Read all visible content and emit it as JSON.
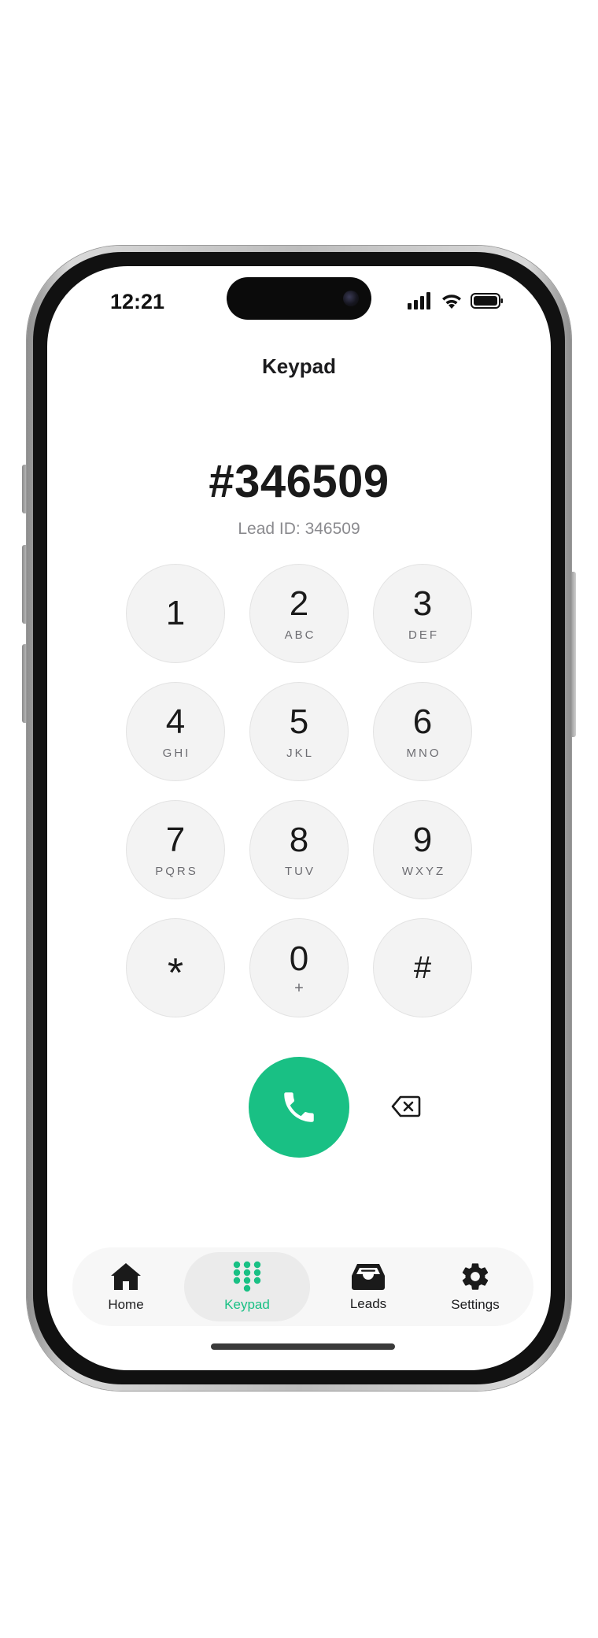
{
  "status_bar": {
    "time": "12:21",
    "icons": [
      "cellular-signal-icon",
      "wifi-icon",
      "battery-icon"
    ]
  },
  "header": {
    "title": "Keypad"
  },
  "dialer": {
    "number": "#346509",
    "lead_label": "Lead ID: 346509"
  },
  "keypad": {
    "keys": [
      {
        "digit": "1",
        "letters": ""
      },
      {
        "digit": "2",
        "letters": "ABC"
      },
      {
        "digit": "3",
        "letters": "DEF"
      },
      {
        "digit": "4",
        "letters": "GHI"
      },
      {
        "digit": "5",
        "letters": "JKL"
      },
      {
        "digit": "6",
        "letters": "MNO"
      },
      {
        "digit": "7",
        "letters": "PQRS"
      },
      {
        "digit": "8",
        "letters": "TUV"
      },
      {
        "digit": "9",
        "letters": "WXYZ"
      },
      {
        "digit": "*",
        "letters": ""
      },
      {
        "digit": "0",
        "letters": "+"
      },
      {
        "digit": "#",
        "letters": ""
      }
    ]
  },
  "actions": {
    "call_icon": "phone-icon",
    "delete_icon": "backspace-icon"
  },
  "tab_bar": {
    "tabs": [
      {
        "label": "Home",
        "icon": "home-icon",
        "active": false
      },
      {
        "label": "Keypad",
        "icon": "keypad-grid-icon",
        "active": true
      },
      {
        "label": "Leads",
        "icon": "inbox-tray-icon",
        "active": false
      },
      {
        "label": "Settings",
        "icon": "gear-icon",
        "active": false
      }
    ]
  },
  "colors": {
    "accent": "#19c084",
    "key_background": "#f3f3f3",
    "text_primary": "#1a1a1a",
    "text_secondary": "#8a8a8e"
  }
}
